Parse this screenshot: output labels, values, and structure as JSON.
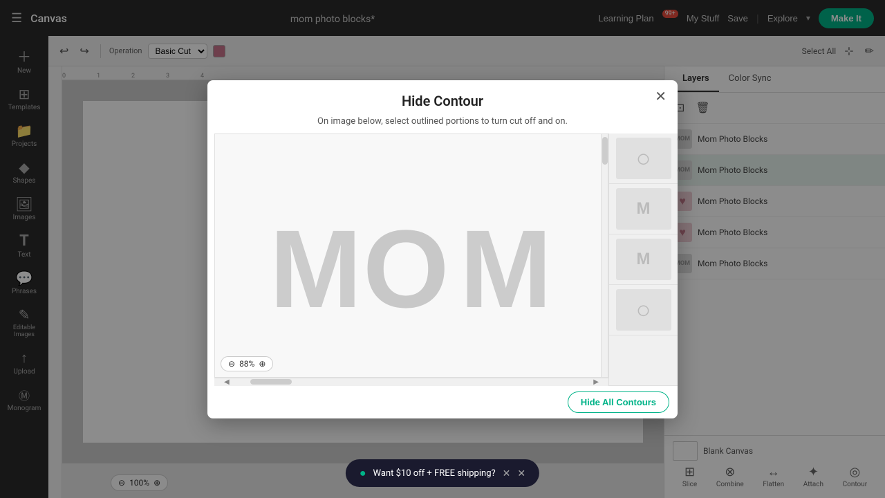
{
  "topbar": {
    "hamburger": "☰",
    "logo": "Canvas",
    "title": "mom photo blocks*",
    "learning_plan": "Learning Plan",
    "badge": "99+",
    "my_stuff": "My Stuff",
    "save": "Save",
    "explore": "Explore",
    "make_it": "Make It"
  },
  "toolbar": {
    "operation_label": "Operation",
    "operation_value": "Basic Cut",
    "select_all": "Select All",
    "undo_icon": "↩",
    "redo_icon": "↪"
  },
  "left_sidebar": {
    "items": [
      {
        "icon": "＋",
        "label": "New"
      },
      {
        "icon": "⊞",
        "label": "Templates"
      },
      {
        "icon": "📁",
        "label": "Projects"
      },
      {
        "icon": "◆",
        "label": "Shapes"
      },
      {
        "icon": "🖼",
        "label": "Images"
      },
      {
        "icon": "T",
        "label": "Text"
      },
      {
        "icon": "💬",
        "label": "Phrases"
      },
      {
        "icon": "✎",
        "label": "Editable Images"
      },
      {
        "icon": "↑",
        "label": "Upload"
      },
      {
        "icon": "M",
        "label": "Monogram"
      }
    ]
  },
  "canvas": {
    "zoom_minus": "⊖",
    "zoom_level": "100%",
    "zoom_plus": "⊕"
  },
  "right_panel": {
    "tabs": [
      "Layers",
      "Color Sync"
    ],
    "active_tab": "Layers",
    "layers": [
      {
        "id": 1,
        "label": "Mom Photo Blocks",
        "type": "text",
        "active": false
      },
      {
        "id": 2,
        "label": "Mom Photo Blocks",
        "type": "text",
        "active": true
      },
      {
        "id": 3,
        "label": "Mom Photo Blocks",
        "type": "heart",
        "active": false
      },
      {
        "id": 4,
        "label": "Mom Photo Blocks",
        "type": "heart",
        "active": false
      },
      {
        "id": 5,
        "label": "Mom Photo Blocks",
        "type": "text",
        "active": false
      }
    ],
    "blank_canvas": "Blank Canvas",
    "bottom_tools": [
      {
        "icon": "⊞",
        "label": "Slice"
      },
      {
        "icon": "⊗",
        "label": "Combine"
      },
      {
        "icon": "↔",
        "label": "Flatten"
      },
      {
        "icon": "✦",
        "label": "Attach"
      },
      {
        "icon": "◎",
        "label": "Contour"
      }
    ]
  },
  "modal": {
    "title": "Hide Contour",
    "subtitle": "On image below, select outlined portions to turn cut off and on.",
    "close_icon": "✕",
    "zoom_minus": "⊖",
    "zoom_level": "88%",
    "zoom_plus": "⊕",
    "hide_all_contours": "Hide All Contours",
    "letters": [
      "M",
      "O",
      "M"
    ],
    "thumbs": [
      {
        "content": "O",
        "type": "circle"
      },
      {
        "content": "M",
        "type": "letter"
      },
      {
        "content": "M",
        "type": "letter2"
      },
      {
        "content": "O",
        "type": "circle2"
      },
      {
        "content": "",
        "type": "empty"
      }
    ]
  },
  "toast": {
    "icon": "●",
    "text": "Want $10 off + FREE shipping?",
    "close": "✕",
    "dismiss": "✕"
  }
}
